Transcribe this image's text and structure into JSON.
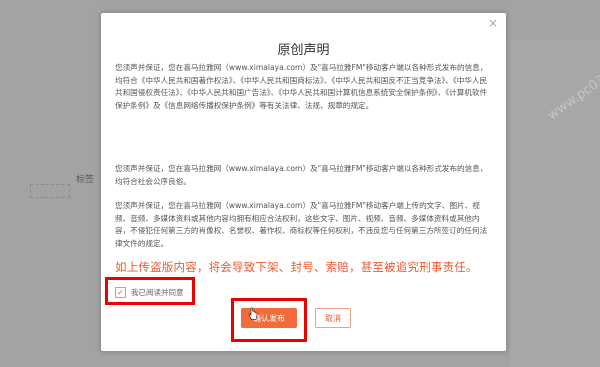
{
  "background": {
    "left_label": "标签",
    "watermark": "www.pc0359.cn"
  },
  "dialog": {
    "close_glyph": "×",
    "title": "原创声明",
    "paragraphs": [
      "您须声并保证，您在喜马拉雅网（www.ximalaya.com）及\"喜马拉雅FM\"移动客户端以各种形式发布的信息，均符合《中华人民共和国著作权法》、《中华人民共和国商标法》、《中华人民共和国反不正当竞争法》、《中华人民共和国侵权责任法》、《中华人民共和国广告法》、《中华人民共和国计算机信息系统安全保护条例》、《计算机软件保护条例》及《信息网络传播权保护条例》等有关法律、法规、规章的规定。",
      "您须声并保证，您在喜马拉雅网（www.ximalaya.com）及\"喜马拉雅FM\"移动客户端以各种形式发布的信息，均符合社会公序良俗。",
      "您须声并保证，您在喜马拉雅网（www.ximalaya.com）及\"喜马拉雅FM\"移动客户端上传的文字、图片、视频、音频、多媒体资料或其他内容均拥有相应合法权利，这些文字、图片、视频、音频、多媒体资料或其他内容，不侵犯任何第三方的肖像权、名誉权、著作权、商标权等任何权利，不违反您与任何第三方所签订的任何法律文件的规定。"
    ],
    "warning": "如上传盗版内容，将会导致下架、封号、索赔，甚至被追究刑事责任。",
    "agree_checked": "✓",
    "agree_label": "我已阅读并同意",
    "confirm_label": "确认发布",
    "cancel_label": "取消"
  },
  "colors": {
    "accent": "#f26b38",
    "warning": "#ee5a2e",
    "highlight": "#ee0000"
  }
}
